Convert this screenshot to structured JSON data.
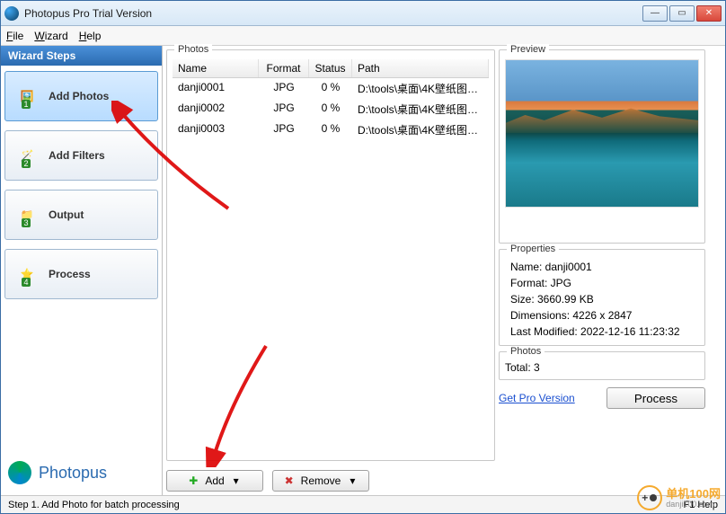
{
  "titlebar": {
    "title": "Photopus Pro Trial Version"
  },
  "menu": {
    "file": "File",
    "wizard": "Wizard",
    "help": "Help"
  },
  "sidebar": {
    "header": "Wizard Steps",
    "steps": [
      {
        "label": "Add Photos"
      },
      {
        "label": "Add Filters"
      },
      {
        "label": "Output"
      },
      {
        "label": "Process"
      }
    ],
    "brand": "Photopus"
  },
  "photos": {
    "caption": "Photos",
    "headers": {
      "name": "Name",
      "format": "Format",
      "status": "Status",
      "path": "Path"
    },
    "rows": [
      {
        "name": "danji0001",
        "format": "JPG",
        "status": "0 %",
        "path": "D:\\tools\\桌面\\4K壁纸图片..."
      },
      {
        "name": "danji0002",
        "format": "JPG",
        "status": "0 %",
        "path": "D:\\tools\\桌面\\4K壁纸图片..."
      },
      {
        "name": "danji0003",
        "format": "JPG",
        "status": "0 %",
        "path": "D:\\tools\\桌面\\4K壁纸图片..."
      }
    ],
    "add_label": "Add",
    "remove_label": "Remove"
  },
  "preview": {
    "caption": "Preview"
  },
  "properties": {
    "caption": "Properties",
    "name": "Name: danji0001",
    "format": "Format: JPG",
    "size": "Size: 3660.99 KB",
    "dimensions": "Dimensions: 4226 x 2847",
    "last_modified": "Last Modified: 2022-12-16 11:23:32"
  },
  "photo_count": {
    "caption": "Photos",
    "total": "Total: 3"
  },
  "footer": {
    "get_pro": "Get Pro Version",
    "process": "Process"
  },
  "statusbar": {
    "left": "Step 1. Add Photo for batch processing",
    "right": "F1 Help"
  },
  "watermark": {
    "text": "单机100网",
    "sub": "danji100.com"
  }
}
